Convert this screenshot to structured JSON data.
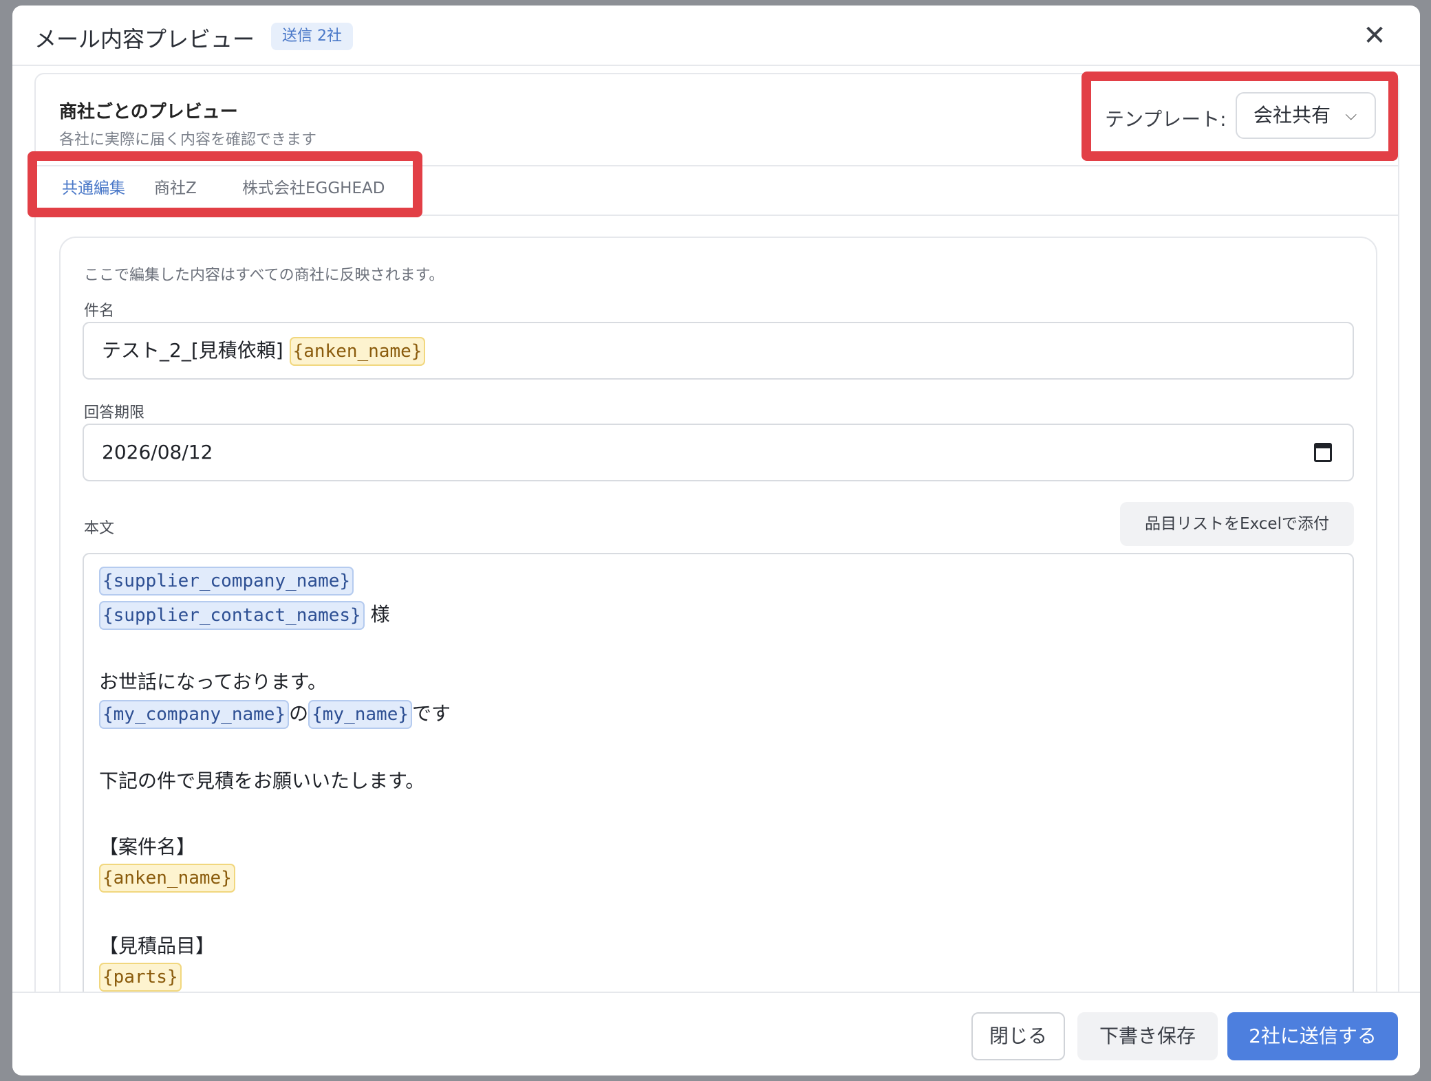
{
  "header": {
    "title": "メール内容プレビュー",
    "badge": "送信 2社",
    "close_icon": "✕"
  },
  "panel": {
    "title": "商社ごとのプレビュー",
    "subtitle": "各社に実際に届く内容を確認できます",
    "template_label": "テンプレート:",
    "template_value": "会社共有",
    "template_chevron": "⌵"
  },
  "tabs": [
    {
      "label": "共通編集",
      "active": true
    },
    {
      "label": "商社Z",
      "active": false
    },
    {
      "label": "株式会社EGGHEAD",
      "active": false
    }
  ],
  "editor": {
    "hint": "ここで編集した内容はすべての商社に反映されます。",
    "subject_label": "件名",
    "subject_text": "テスト_2_[見積依頼]",
    "subject_token": "{anken_name}",
    "deadline_label": "回答期限",
    "deadline_value": "2026/08/12",
    "body_label": "本文",
    "excel_button": "品目リストをExcelで添付",
    "body": {
      "token_supplier_company": "{supplier_company_name}",
      "token_supplier_contacts": "{supplier_contact_names}",
      "sama": "様",
      "greeting": "お世話になっております。",
      "token_my_company": "{my_company_name}",
      "no": "の",
      "token_my_name": "{my_name}",
      "desu": "です",
      "request": "下記の件で見積をお願いいたします。",
      "section_anken": "【案件名】",
      "token_anken": "{anken_name}",
      "section_items": "【見積品目】",
      "token_parts": "{parts}"
    }
  },
  "footer": {
    "close_label": "閉じる",
    "draft_label": "下書き保存",
    "send_label": "2社に送信する"
  },
  "colors": {
    "accent": "#4d7fde",
    "highlight_red": "#e23f46",
    "token_blue_bg": "#e1ebfb",
    "token_yellow_bg": "#fdf3cf"
  }
}
